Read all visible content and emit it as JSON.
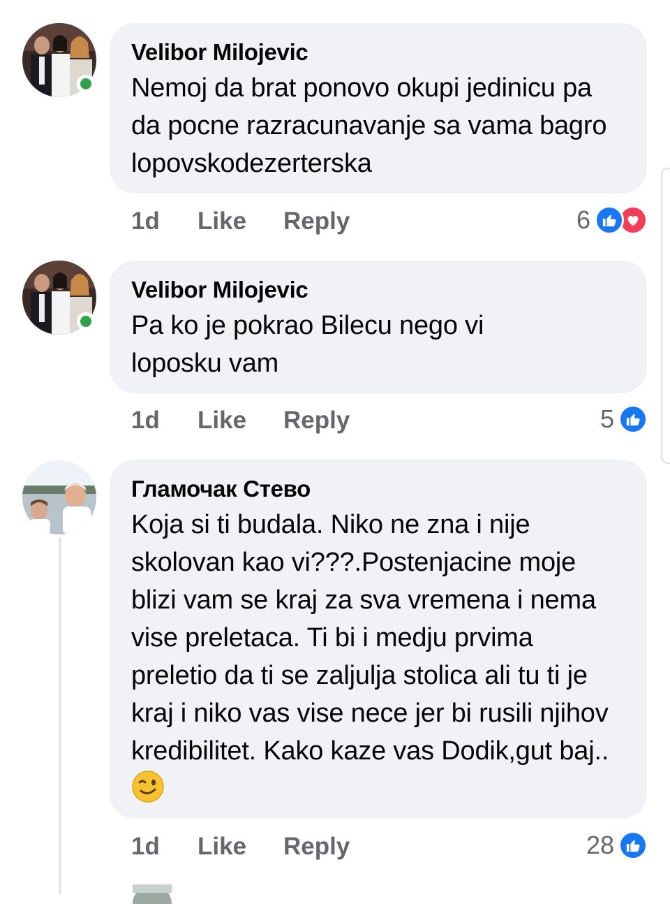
{
  "comments": [
    {
      "author": "Velibor Milojevic",
      "body": "Nemoj da brat ponovo okupi jedinicu pa da pocne razracunavanje sa vama bagro lopovskodezerterska",
      "time": "1d",
      "like_label": "Like",
      "reply_label": "Reply",
      "reaction_count": "6",
      "reactions": [
        "like-icon",
        "love-icon"
      ],
      "online": true
    },
    {
      "author": "Velibor Milojevic",
      "body": "Pa ko je pokrao Bilecu nego vi loposku vam",
      "time": "1d",
      "like_label": "Like",
      "reply_label": "Reply",
      "reaction_count": "5",
      "reactions": [
        "like-icon"
      ],
      "online": true
    },
    {
      "author": "Гламочак Стево",
      "body": "Koja si ti budala. Niko ne zna i  nije skolovan kao vi???.Postenjacine moje blizi vam se kraj za sva vremena i nema vise preletaca. Ti bi i medju prvima preletio da ti se zaljulja stolica ali tu ti je kraj i niko vas vise nece jer bi rusili njihov kredibilitet. Kako kaze vas Dodik,gut baj..",
      "body_emoji": "winking-face-emoji",
      "time": "1d",
      "like_label": "Like",
      "reply_label": "Reply",
      "reaction_count": "28",
      "reactions": [
        "like-icon"
      ],
      "online": false
    }
  ],
  "colors": {
    "bubble_bg": "#f0f2f5",
    "meta_text": "#65676b",
    "like_blue": "#1877f2",
    "love_red": "#f33e58",
    "online_green": "#31a24c"
  }
}
